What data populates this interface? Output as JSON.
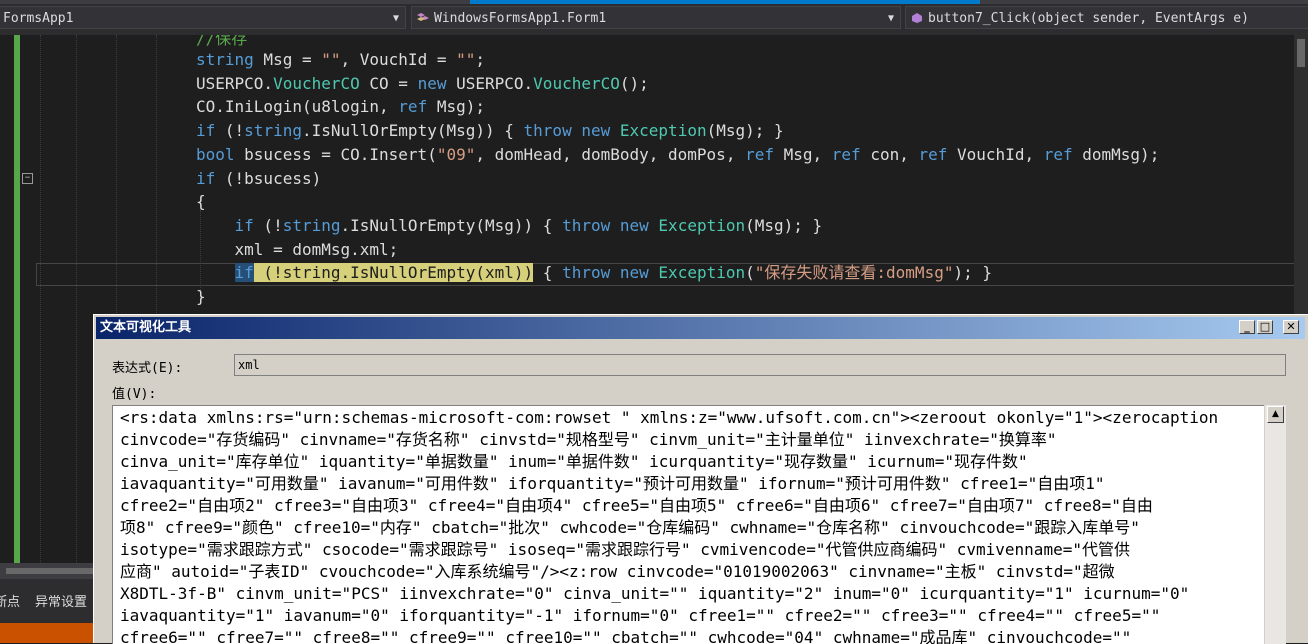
{
  "nav": {
    "project_combo": "FormsApp1",
    "class_combo": "WindowsFormsApp1.Form1",
    "member_combo": "button7_Click(object sender, EventArgs e)"
  },
  "code": {
    "comment": "//保存",
    "lines": [
      [
        {
          "t": "string",
          "c": "kw"
        },
        {
          "t": " Msg = ",
          "c": ""
        },
        {
          "t": "\"\"",
          "c": "st"
        },
        {
          "t": ", VouchId = ",
          "c": ""
        },
        {
          "t": "\"\"",
          "c": "st"
        },
        {
          "t": ";",
          "c": ""
        }
      ],
      [
        {
          "t": "USERPCO.",
          "c": ""
        },
        {
          "t": "VoucherCO",
          "c": "ty"
        },
        {
          "t": " CO = ",
          "c": ""
        },
        {
          "t": "new",
          "c": "kw"
        },
        {
          "t": " USERPCO.",
          "c": ""
        },
        {
          "t": "VoucherCO",
          "c": "ty"
        },
        {
          "t": "();",
          "c": ""
        }
      ],
      [
        {
          "t": "CO.IniLogin(u8login, ",
          "c": ""
        },
        {
          "t": "ref",
          "c": "kw"
        },
        {
          "t": " Msg);",
          "c": ""
        }
      ],
      [
        {
          "t": "if",
          "c": "kw"
        },
        {
          "t": " (!",
          "c": ""
        },
        {
          "t": "string",
          "c": "kw"
        },
        {
          "t": ".IsNullOrEmpty(Msg)) { ",
          "c": ""
        },
        {
          "t": "throw",
          "c": "kw"
        },
        {
          "t": " ",
          "c": ""
        },
        {
          "t": "new",
          "c": "kw"
        },
        {
          "t": " ",
          "c": ""
        },
        {
          "t": "Exception",
          "c": "ty"
        },
        {
          "t": "(Msg); }",
          "c": ""
        }
      ],
      [
        {
          "t": "bool",
          "c": "kw"
        },
        {
          "t": " bsucess = CO.Insert(",
          "c": ""
        },
        {
          "t": "\"09\"",
          "c": "st"
        },
        {
          "t": ", domHead, domBody, domPos, ",
          "c": ""
        },
        {
          "t": "ref",
          "c": "kw"
        },
        {
          "t": " Msg, ",
          "c": ""
        },
        {
          "t": "ref",
          "c": "kw"
        },
        {
          "t": " con, ",
          "c": ""
        },
        {
          "t": "ref",
          "c": "kw"
        },
        {
          "t": " VouchId, ",
          "c": ""
        },
        {
          "t": "ref",
          "c": "kw"
        },
        {
          "t": " domMsg);",
          "c": ""
        }
      ],
      [
        {
          "t": "if",
          "c": "kw"
        },
        {
          "t": " (!bsucess)",
          "c": ""
        }
      ],
      [
        {
          "t": "{",
          "c": ""
        }
      ],
      [
        {
          "t": "    ",
          "c": ""
        },
        {
          "t": "if",
          "c": "kw"
        },
        {
          "t": " (!",
          "c": ""
        },
        {
          "t": "string",
          "c": "kw"
        },
        {
          "t": ".IsNullOrEmpty(Msg)) { ",
          "c": ""
        },
        {
          "t": "throw",
          "c": "kw"
        },
        {
          "t": " ",
          "c": ""
        },
        {
          "t": "new",
          "c": "kw"
        },
        {
          "t": " ",
          "c": ""
        },
        {
          "t": "Exception",
          "c": "ty"
        },
        {
          "t": "(Msg); }",
          "c": ""
        }
      ],
      [
        {
          "t": "    xml = domMsg.xml;",
          "c": ""
        }
      ],
      [
        {
          "t": "    ",
          "c": ""
        },
        {
          "t": "if",
          "c": "kw hl-sel"
        },
        {
          "t": " (!",
          "c": "hl-yellow"
        },
        {
          "t": "string",
          "c": "hl-yellow"
        },
        {
          "t": ".IsNullOrEmpty(xml))",
          "c": "hl-yellow"
        },
        {
          "t": " { ",
          "c": ""
        },
        {
          "t": "throw",
          "c": "kw"
        },
        {
          "t": " ",
          "c": ""
        },
        {
          "t": "new",
          "c": "kw"
        },
        {
          "t": " ",
          "c": ""
        },
        {
          "t": "Exception",
          "c": "ty"
        },
        {
          "t": "(",
          "c": ""
        },
        {
          "t": "\"保存失败请查看:domMsg\"",
          "c": "st"
        },
        {
          "t": "); }",
          "c": ""
        }
      ],
      [
        {
          "t": "}",
          "c": ""
        }
      ]
    ]
  },
  "bottom": {
    "tab_breakpoints": "断点",
    "tab_exceptions": "异常设置"
  },
  "dialog": {
    "title": "文本可视化工具",
    "min_button": "_",
    "max_button": "□",
    "close_button": "✕",
    "expression_label": "表达式(E):",
    "expression_value": "xml",
    "value_label": "值(V):",
    "value_lines": [
      "<rs:data xmlns:rs=\"urn:schemas-microsoft-com:rowset \" xmlns:z=\"www.ufsoft.com.cn\"><zeroout okonly=\"1\"><zerocaption",
      "cinvcode=\"存货编码\" cinvname=\"存货名称\" cinvstd=\"规格型号\" cinvm_unit=\"主计量单位\" iinvexchrate=\"换算率\"",
      "cinva_unit=\"库存单位\" iquantity=\"单据数量\" inum=\"单据件数\" icurquantity=\"现存数量\" icurnum=\"现存件数\"",
      "iavaquantity=\"可用数量\" iavanum=\"可用件数\" iforquantity=\"预计可用数量\" ifornum=\"预计可用件数\" cfree1=\"自由项1\"",
      "cfree2=\"自由项2\" cfree3=\"自由项3\" cfree4=\"自由项4\" cfree5=\"自由项5\" cfree6=\"自由项6\" cfree7=\"自由项7\" cfree8=\"自由",
      "项8\" cfree9=\"颜色\" cfree10=\"内存\" cbatch=\"批次\" cwhcode=\"仓库编码\" cwhname=\"仓库名称\" cinvouchcode=\"跟踪入库单号\"",
      "isotype=\"需求跟踪方式\" csocode=\"需求跟踪号\" isoseq=\"需求跟踪行号\" cvmivencode=\"代管供应商编码\" cvmivenname=\"代管供",
      "应商\" autoid=\"子表ID\" cvouchcode=\"入库系统编号\"/><z:row cinvcode=\"01019002063\" cinvname=\"主板\" cinvstd=\"超微",
      "X8DTL-3f-B\" cinvm_unit=\"PCS\" iinvexchrate=\"0\" cinva_unit=\"\" iquantity=\"2\" inum=\"0\" icurquantity=\"1\" icurnum=\"0\"",
      "iavaquantity=\"1\" iavanum=\"0\" iforquantity=\"-1\" ifornum=\"0\" cfree1=\"\" cfree2=\"\" cfree3=\"\" cfree4=\"\" cfree5=\"\"",
      "cfree6=\"\" cfree7=\"\" cfree8=\"\" cfree9=\"\" cfree10=\"\" cbatch=\"\" cwhcode=\"04\" cwhname=\"成品库\" cinvouchcode=\"\""
    ]
  }
}
